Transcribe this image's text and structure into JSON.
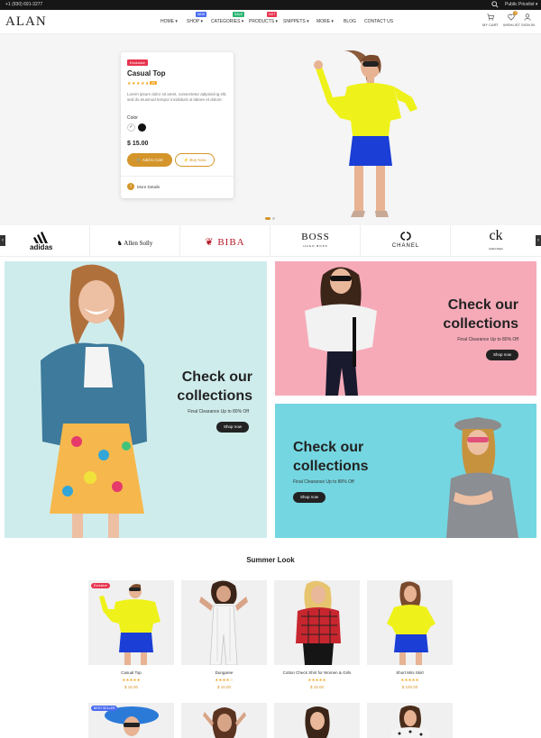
{
  "topbar": {
    "phone": "+1 (930) 691-3277",
    "price_list": "Public Pricelist"
  },
  "header": {
    "logo": "ALAN",
    "nav": [
      {
        "label": "HOME",
        "caret": true
      },
      {
        "label": "SHOP",
        "caret": true,
        "badge": "NEW",
        "badge_color": "#4b6cf0"
      },
      {
        "label": "CATEGORIES",
        "caret": true,
        "badge": "SALE",
        "badge_color": "#2bb673"
      },
      {
        "label": "PRODUCTS",
        "caret": true,
        "badge": "HOT",
        "badge_color": "#e8344e"
      },
      {
        "label": "SNIPPETS",
        "caret": true
      },
      {
        "label": "MORE",
        "caret": true
      },
      {
        "label": "BLOG",
        "caret": false
      },
      {
        "label": "CONTACT US",
        "caret": false
      }
    ],
    "icons": [
      {
        "label": "MY CART",
        "icon": "cart-icon"
      },
      {
        "label": "WISHLIST",
        "icon": "heart-icon",
        "count": "0"
      },
      {
        "label": "SIGN IN",
        "icon": "user-icon"
      }
    ]
  },
  "hero": {
    "tag": "Exclusive",
    "title": "Casual Top",
    "stars": "★★★★★",
    "rating_count": "(0)",
    "description": "Lorem ipsum dolor sit amet, consectetur adipisicing elit, sed do eiusmod tempor incididunt ut labore et dolore",
    "color_label": "Color",
    "price": "$ 15.00",
    "add_to_cart": "🛒 Add to Cart",
    "buy_now": "⚡ Buy Now",
    "more_details": "More Details"
  },
  "brands": [
    "adidas",
    "Allen Solly",
    "BIBA",
    "BOSS",
    "CHANEL",
    "ck"
  ],
  "brand_subs": {
    "boss": "HUGO BOSS",
    "ck": "Calvin Klein"
  },
  "banners": {
    "left": {
      "heading_1": "Check our",
      "heading_2": "collections",
      "sub": "Final Clearance Up to 80% Off",
      "button": "Shop now"
    },
    "top_right": {
      "heading_1": "Check our",
      "heading_2": "collections",
      "sub": "Final Clearance Up to 80% Off",
      "button": "Shop now"
    },
    "bottom_right": {
      "heading_1": "Check our",
      "heading_2": "collections",
      "sub": "Final Clearance Up to 80% Off",
      "button": "Shop now"
    }
  },
  "summer": {
    "title": "Summer Look",
    "products": [
      {
        "name": "Casual Top",
        "stars": "★★★★★",
        "price": "$ 15.00",
        "tag": "Exclusive"
      },
      {
        "name": "Dungaree",
        "stars": "★★★★☆",
        "price": "$ 15.00"
      },
      {
        "name": "Cotton Check Shirt for Women & Girls",
        "stars": "★★★★★",
        "price": "$ 15.00"
      },
      {
        "name": "Short Mini Skirt",
        "stars": "★★★★★",
        "price": "$ 100.00"
      }
    ],
    "second_row_tag": "BEST SELLER"
  },
  "colors": {
    "accent": "#d4952b",
    "exclusive": "#e8344e",
    "star": "#f5a623",
    "best_seller": "#4b6cf0"
  }
}
